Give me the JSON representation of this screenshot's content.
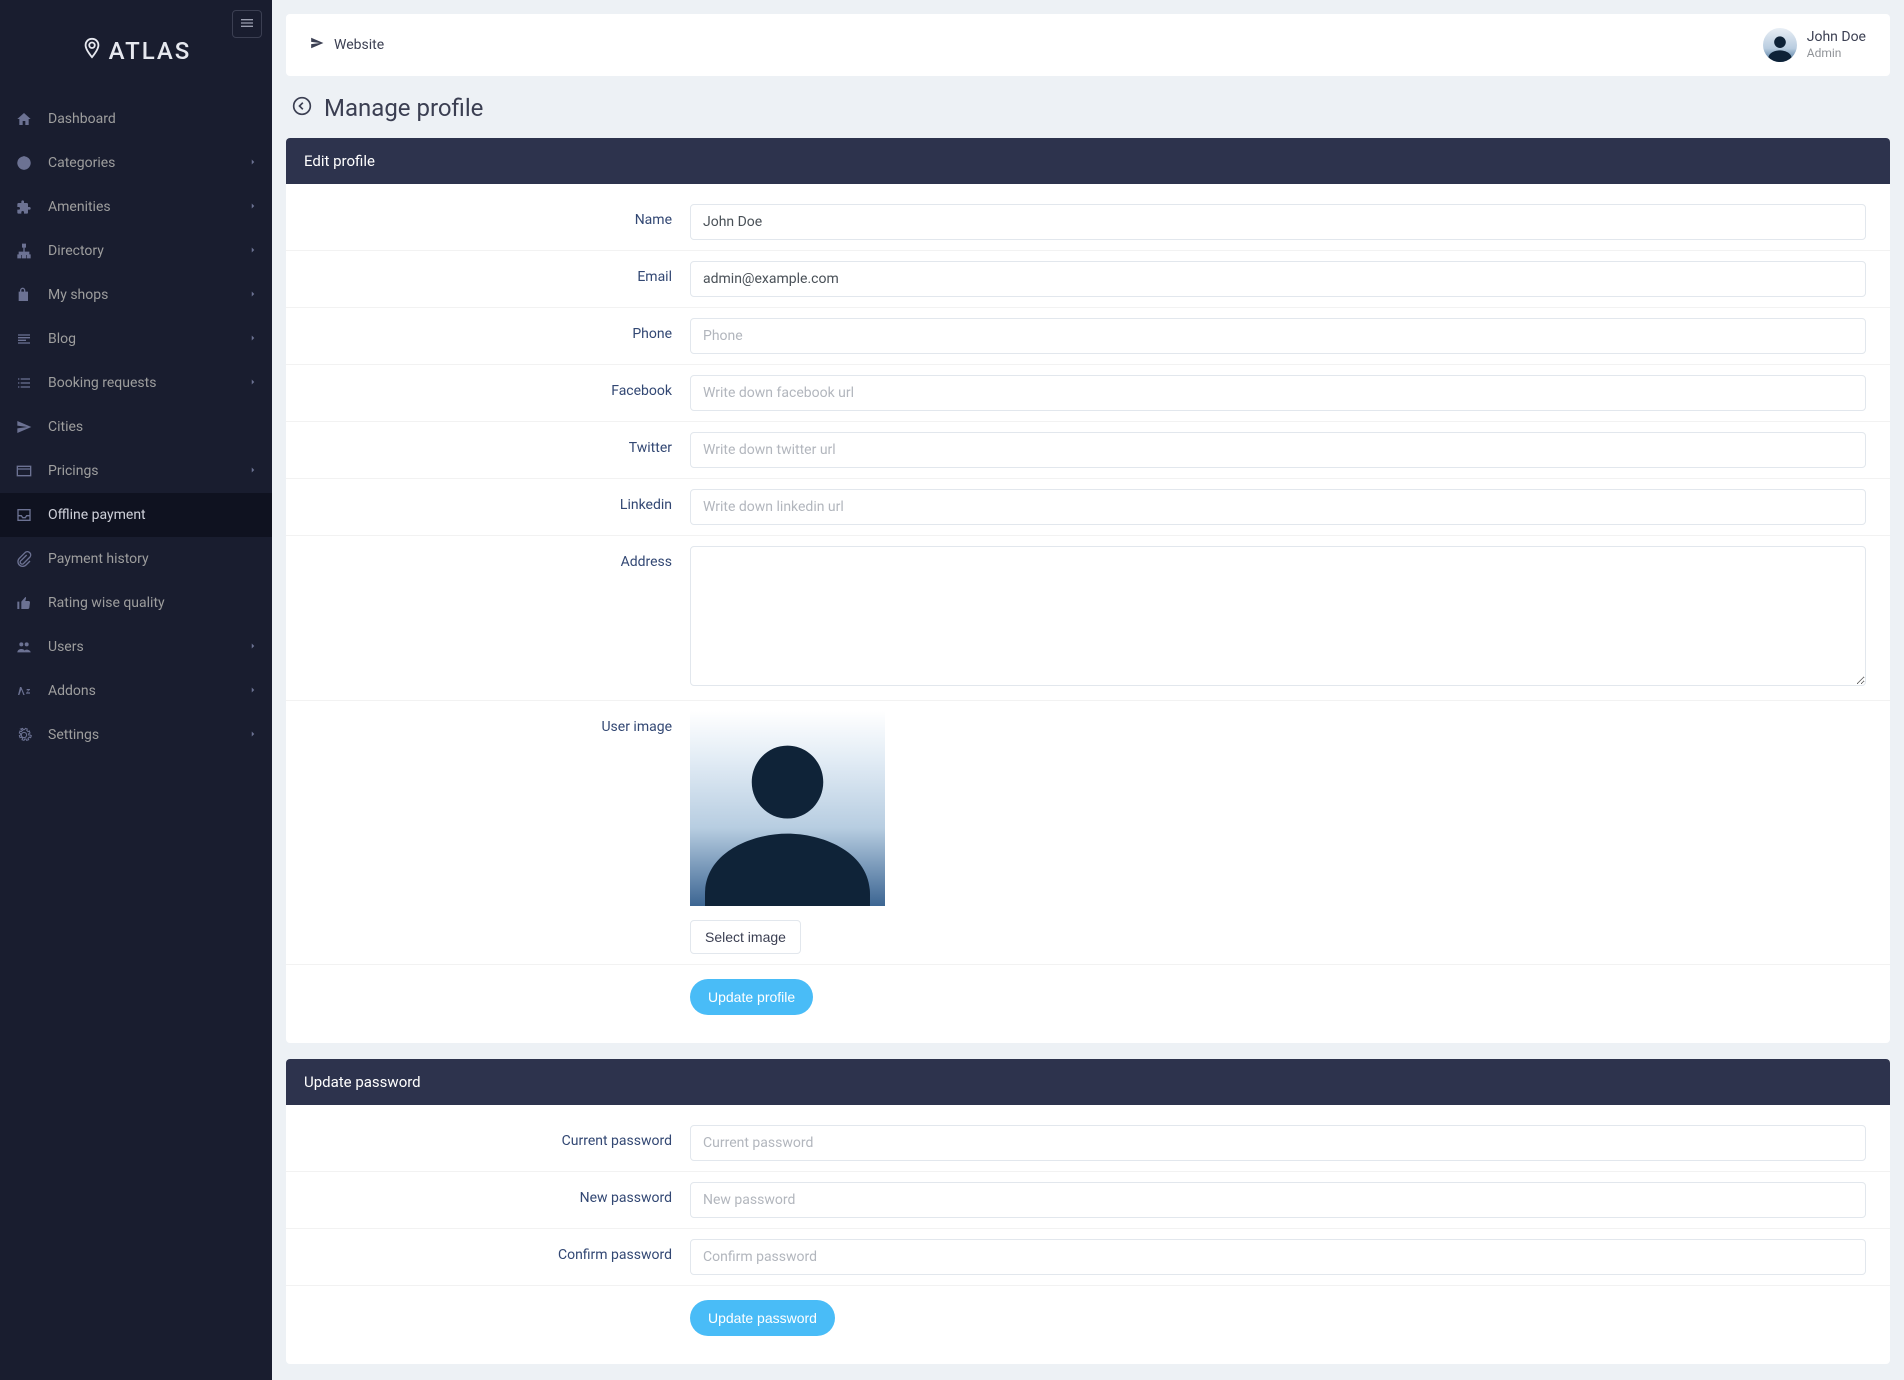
{
  "brand": "ATLAS",
  "sidebar": {
    "items": [
      {
        "label": "Dashboard",
        "icon": "home",
        "expandable": false
      },
      {
        "label": "Categories",
        "icon": "grid",
        "expandable": true
      },
      {
        "label": "Amenities",
        "icon": "puzzle",
        "expandable": true
      },
      {
        "label": "Directory",
        "icon": "sitemap",
        "expandable": true
      },
      {
        "label": "My shops",
        "icon": "bag",
        "expandable": true
      },
      {
        "label": "Blog",
        "icon": "lines",
        "expandable": true
      },
      {
        "label": "Booking requests",
        "icon": "list",
        "expandable": true
      },
      {
        "label": "Cities",
        "icon": "location",
        "expandable": false
      },
      {
        "label": "Pricings",
        "icon": "card",
        "expandable": true
      },
      {
        "label": "Offline payment",
        "icon": "inbox",
        "expandable": false,
        "active": true
      },
      {
        "label": "Payment history",
        "icon": "clip",
        "expandable": false
      },
      {
        "label": "Rating wise quality",
        "icon": "thumb",
        "expandable": false
      },
      {
        "label": "Users",
        "icon": "users",
        "expandable": true
      },
      {
        "label": "Addons",
        "icon": "sup",
        "expandable": true
      },
      {
        "label": "Settings",
        "icon": "gears",
        "expandable": true
      }
    ]
  },
  "topbar": {
    "website": "Website",
    "user_name": "John Doe",
    "user_role": "Admin"
  },
  "page": {
    "title": "Manage profile"
  },
  "profile": {
    "header": "Edit profile",
    "labels": {
      "name": "Name",
      "email": "Email",
      "phone": "Phone",
      "facebook": "Facebook",
      "twitter": "Twitter",
      "linkedin": "Linkedin",
      "address": "Address",
      "user_image": "User image"
    },
    "values": {
      "name": "John Doe",
      "email": "admin@example.com",
      "phone": "",
      "facebook": "",
      "twitter": "",
      "linkedin": "",
      "address": ""
    },
    "placeholders": {
      "phone": "Phone",
      "facebook": "Write down facebook url",
      "twitter": "Write down twitter url",
      "linkedin": "Write down linkedin url"
    },
    "select_image": "Select image",
    "submit": "Update profile"
  },
  "password": {
    "header": "Update password",
    "labels": {
      "current": "Current password",
      "new": "New password",
      "confirm": "Confirm password"
    },
    "placeholders": {
      "current": "Current password",
      "new": "New password",
      "confirm": "Confirm password"
    },
    "submit": "Update password"
  }
}
